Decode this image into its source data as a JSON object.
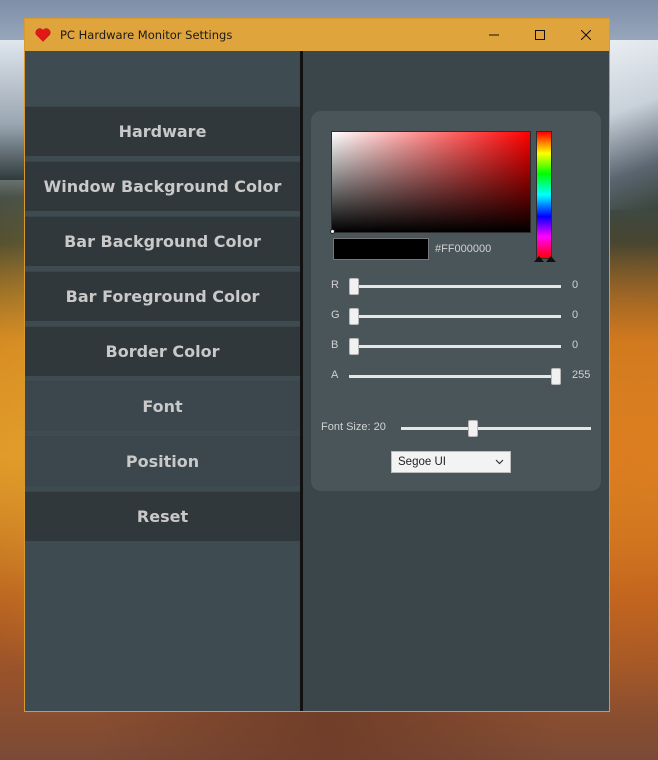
{
  "window": {
    "title": "PC Hardware Monitor Settings",
    "app_icon": "heart-icon",
    "controls": [
      "minimize-icon",
      "maximize-icon",
      "close-icon"
    ]
  },
  "sidebar": {
    "items": [
      {
        "label": "Hardware"
      },
      {
        "label": "Window Background Color"
      },
      {
        "label": "Bar Background Color"
      },
      {
        "label": "Bar Foreground Color"
      },
      {
        "label": "Border Color"
      },
      {
        "label": "Font"
      },
      {
        "label": "Position"
      },
      {
        "label": "Reset"
      }
    ]
  },
  "color_picker": {
    "hex": "#FF000000",
    "hue_color": "#ff0000",
    "preview_color": "#000000",
    "sliders": [
      {
        "label": "R",
        "value": "0",
        "fraction": 0.0
      },
      {
        "label": "G",
        "value": "0",
        "fraction": 0.0
      },
      {
        "label": "B",
        "value": "0",
        "fraction": 0.0
      },
      {
        "label": "A",
        "value": "255",
        "fraction": 1.0
      }
    ]
  },
  "font": {
    "size_label": "Font Size: 20",
    "size_fraction": 0.37,
    "family": "Segoe UI"
  },
  "colors": {
    "titlebar": "#e0a43c",
    "sidebar": "#3e4b50",
    "menu_item": "#30383b",
    "main": "#3b464b",
    "panel": "#4a5559"
  }
}
